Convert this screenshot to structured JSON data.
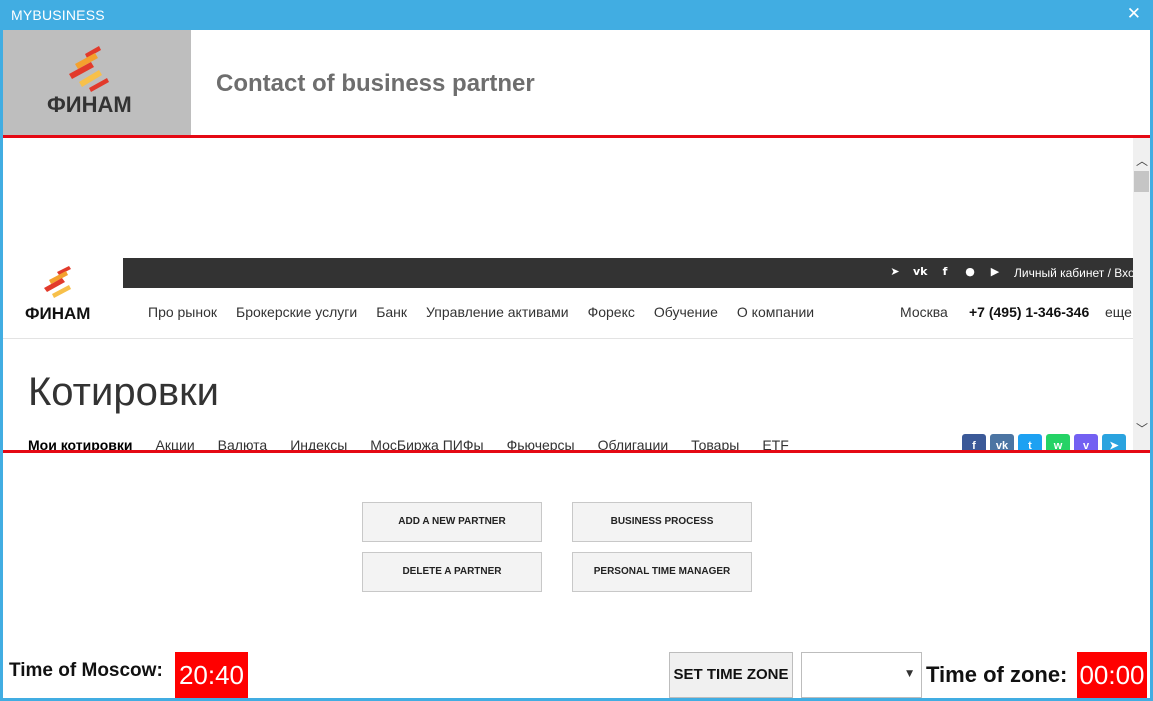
{
  "window": {
    "title": "MYBUSINESS",
    "close_icon": "close-icon"
  },
  "header": {
    "title": "Contact of business partner",
    "logo_text": "ФИНАМ"
  },
  "site": {
    "logo_text": "ФИНАМ",
    "topbar": {
      "icons": [
        "telegram-icon",
        "vk-icon",
        "facebook-icon",
        "odnoklassniki-icon",
        "youtube-icon"
      ],
      "cabinet": "Личный кабинет / Вход"
    },
    "nav": [
      "Про рынок",
      "Брокерские услуги",
      "Банк",
      "Управление активами",
      "Форекс",
      "Обучение",
      "О компании"
    ],
    "city": "Москва",
    "phone": "+7 (495) 1-346-346",
    "more": "еще",
    "heading": "Котировки",
    "subnav": [
      "Мои котировки",
      "Акции",
      "Валюта",
      "Индексы",
      "МосБиржа ПИФы",
      "Фьючерсы",
      "Облигации",
      "Товары",
      "ETF"
    ],
    "share_colors": [
      "#3b5998",
      "#4c75a3",
      "#1da1f2",
      "#25d366",
      "#7360f2",
      "#2aa3df"
    ]
  },
  "buttons": {
    "add_partner": "ADD A NEW PARTNER",
    "business_process": "BUSINESS PROCESS",
    "delete_partner": "DELETE A PARTNER",
    "personal_time_manager": "PERSONAL TIME MANAGER"
  },
  "footer": {
    "moscow_label": "Time of Moscow:",
    "moscow_time": "20:40",
    "set_zone_label": "SET TIME ZONE",
    "zone_select_value": "",
    "zone_label": "Time of zone:",
    "zone_time": "00:00"
  },
  "colors": {
    "accent": "#41ade2",
    "red": "#e50914",
    "clock_bg": "#ff0000"
  }
}
